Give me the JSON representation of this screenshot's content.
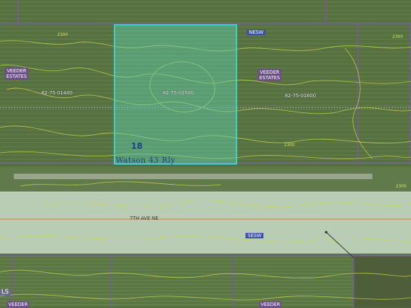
{
  "colors": {
    "field": "#56713f",
    "road": "#b9ccb4",
    "parcel_line": "#7a5aa0",
    "section_line": "#a7a6d0",
    "selection_fill": "#5fd3b4",
    "selection_stroke": "#33e3e6",
    "contour": "#cfd94a"
  },
  "labels": {
    "estates_left": [
      "VEEDER",
      "ESTATES"
    ],
    "estates_right": [
      "VEEDER",
      "ESTATES"
    ],
    "estates_bottom_left": "VEEDER",
    "estates_bottom_right": "VEEDER",
    "parcel_left": "82-75-01400",
    "parcel_selected": "82-75-01500",
    "parcel_right": "82-75-01600",
    "quarter_top": "NESW",
    "quarter_bottom": "SESW",
    "lot_number": "18",
    "street": "7TH AVE NE",
    "overlap_text": "Watson 43 Rly",
    "corner_left": "LS"
  },
  "contour_tags": [
    "2300",
    "2300",
    "2300",
    "2300"
  ]
}
